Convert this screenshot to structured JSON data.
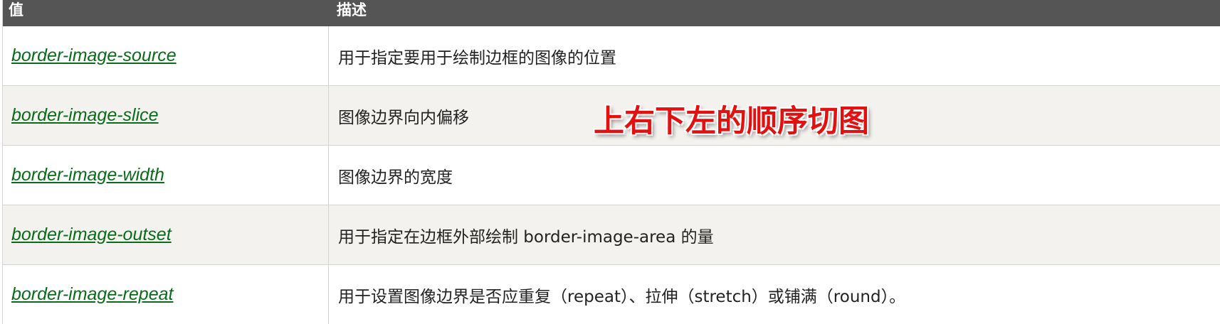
{
  "table": {
    "headers": [
      "值",
      "描述"
    ],
    "rows": [
      {
        "property": "border-image-source",
        "description": "用于指定要用于绘制边框的图像的位置"
      },
      {
        "property": "border-image-slice",
        "description": "图像边界向内偏移"
      },
      {
        "property": "border-image-width",
        "description": "图像边界的宽度"
      },
      {
        "property": "border-image-outset",
        "description": "用于指定在边框外部绘制 border-image-area 的量"
      },
      {
        "property": "border-image-repeat",
        "description": "用于设置图像边界是否应重复（repeat）、拉伸（stretch）或铺满（round）。"
      }
    ]
  },
  "annotation": {
    "text": "上右下左的顺序切图",
    "color": "#e4100f"
  },
  "colors": {
    "header_bg": "#555555",
    "link": "#0a6b1a",
    "alt_row_bg": "#f3f2ef"
  }
}
